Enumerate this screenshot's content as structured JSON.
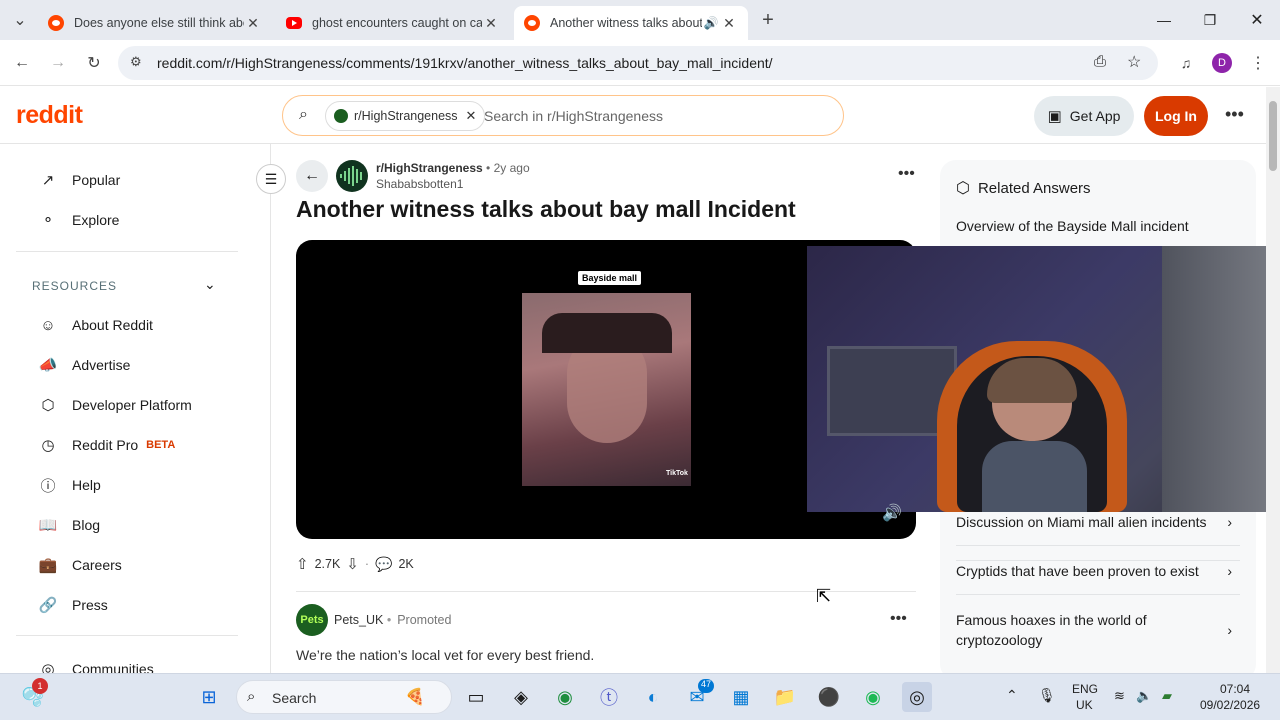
{
  "browser": {
    "tabs": [
      {
        "title": "Does anyone else still think abo",
        "favicon": "reddit-icon",
        "active": false
      },
      {
        "title": "ghost encounters caught on ca",
        "favicon": "youtube-icon",
        "active": false
      },
      {
        "title": "Another witness talks about",
        "favicon": "reddit-icon",
        "active": true
      }
    ],
    "url": "reddit.com/r/HighStrangeness/comments/191krxv/another_witness_talks_about_bay_mall_incident/",
    "profile_initial": "D"
  },
  "header": {
    "logo": "reddit",
    "search_chip": "r/HighStrangeness",
    "search_placeholder": "Search in r/HighStrangeness",
    "get_app": "Get App",
    "login": "Log In"
  },
  "sidebar": {
    "top_items": [
      {
        "label": "Popular",
        "icon": "popular-icon"
      },
      {
        "label": "Explore",
        "icon": "explore-icon"
      }
    ],
    "resources_label": "RESOURCES",
    "resource_items": [
      {
        "label": "About Reddit",
        "icon": "reddit-alien-icon"
      },
      {
        "label": "Advertise",
        "icon": "megaphone-icon"
      },
      {
        "label": "Developer Platform",
        "icon": "hexagon-icon"
      },
      {
        "label": "Reddit Pro",
        "icon": "clock-icon"
      },
      {
        "label": "Help",
        "icon": "help-icon"
      },
      {
        "label": "Blog",
        "icon": "book-icon"
      },
      {
        "label": "Careers",
        "icon": "briefcase-icon"
      },
      {
        "label": "Press",
        "icon": "press-icon"
      }
    ],
    "beta": "BETA",
    "communities": "Communities"
  },
  "post": {
    "subreddit": "r/HighStrangeness",
    "age": "• 2y ago",
    "author": "Shababsbotten1",
    "title": "Another witness talks about bay mall Incident",
    "video_label": "Bayside mall",
    "tiktok": "TikTok",
    "upvotes": "2.7K",
    "comments": "2K"
  },
  "promo": {
    "avatar": "Pets",
    "name": "Pets_UK",
    "promoted": "Promoted",
    "text": "We’re the nation’s local vet for every best friend."
  },
  "related": {
    "title": "Related Answers",
    "items": [
      "Overview of the Bayside Mall incident",
      "Discussion on Miami mall alien incidents",
      "Cryptids that have been proven to exist",
      "Famous hoaxes in the world of cryptozoology"
    ]
  },
  "taskbar": {
    "search": "Search",
    "mail_badge": "47",
    "widget_badge": "1",
    "lang_top": "ENG",
    "lang_bottom": "UK",
    "time": "07:04",
    "date": "09/02/2026"
  }
}
